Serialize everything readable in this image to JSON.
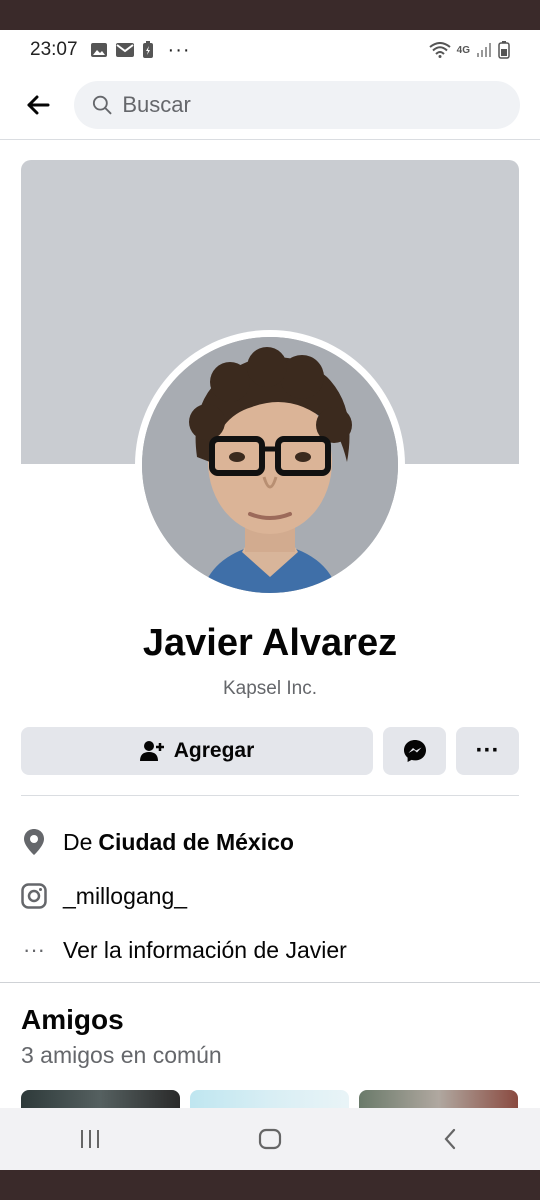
{
  "status_bar": {
    "time": "23:07",
    "network": "4G"
  },
  "header": {
    "search_placeholder": "Buscar"
  },
  "profile": {
    "name": "Javier Alvarez",
    "subtitle": "Kapsel Inc."
  },
  "actions": {
    "add_label": "Agregar"
  },
  "info": {
    "location_prefix": "De",
    "location": "Ciudad de México",
    "instagram": "_millogang_",
    "more_info": "Ver la información de Javier"
  },
  "friends": {
    "title": "Amigos",
    "mutual": "3 amigos en común"
  },
  "colors": {
    "cover": "#c9ccd1",
    "button_bg": "#e4e6eb",
    "secondary_text": "#65676b"
  }
}
